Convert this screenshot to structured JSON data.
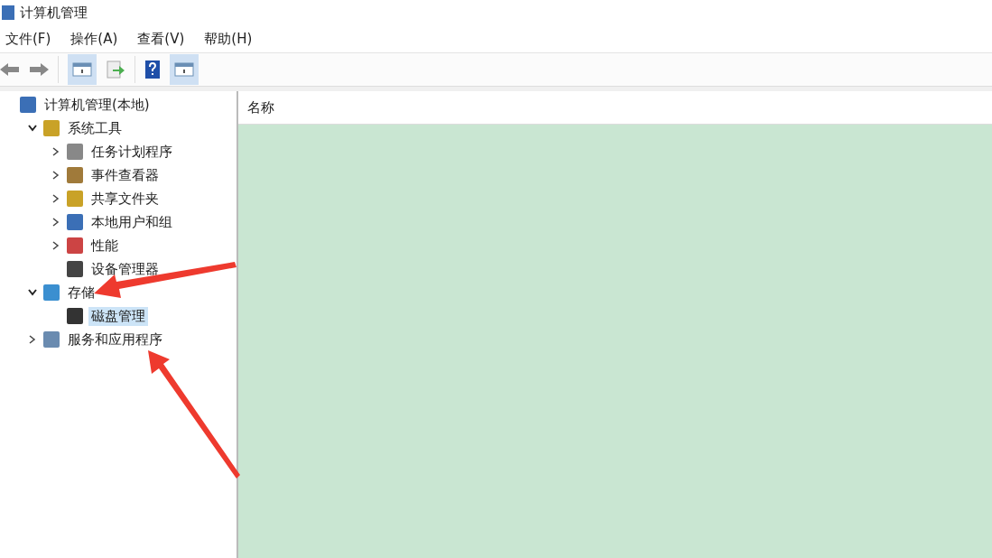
{
  "window": {
    "title": "计算机管理"
  },
  "menu": [
    "文件(F)",
    "操作(A)",
    "查看(V)",
    "帮助(H)"
  ],
  "tree": [
    {
      "label": "计算机管理(本地)",
      "selected": false,
      "children": [
        {
          "label": "系统工具",
          "expanded": true,
          "selected": false,
          "children": [
            {
              "label": "任务计划程序",
              "expanded": false,
              "selected": false
            },
            {
              "label": "事件查看器",
              "expanded": false,
              "selected": false
            },
            {
              "label": "共享文件夹",
              "expanded": false,
              "selected": false
            },
            {
              "label": "本地用户和组",
              "expanded": false,
              "selected": false
            },
            {
              "label": "性能",
              "expanded": false,
              "selected": false
            },
            {
              "label": "设备管理器",
              "selected": false
            }
          ]
        },
        {
          "label": "存储",
          "expanded": true,
          "selected": false,
          "children": [
            {
              "label": "磁盘管理",
              "selected": true
            }
          ]
        },
        {
          "label": "服务和应用程序",
          "expanded": false,
          "selected": false
        }
      ]
    }
  ],
  "list": {
    "columns": [
      "名称"
    ]
  }
}
